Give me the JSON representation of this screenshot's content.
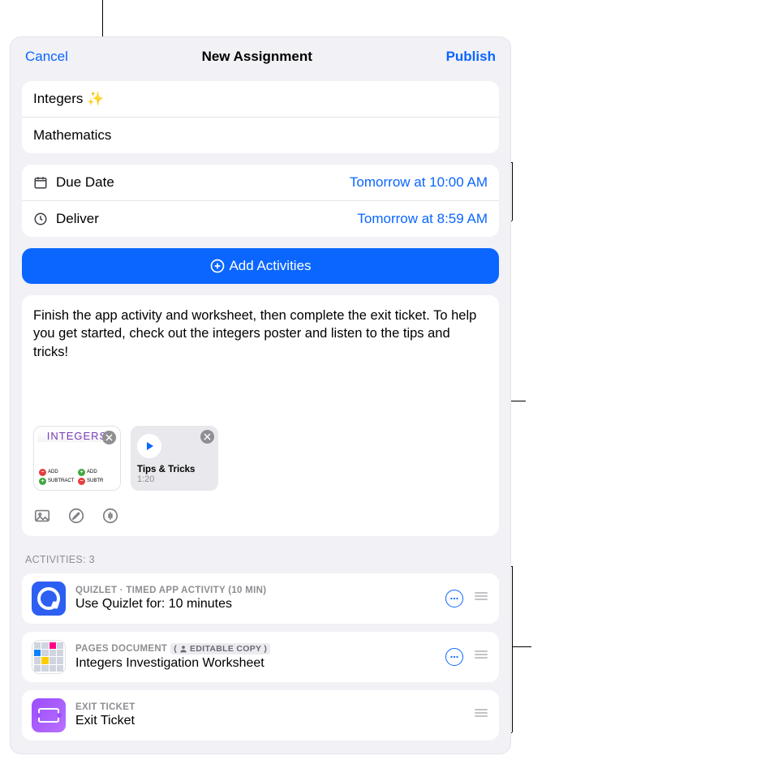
{
  "header": {
    "cancel": "Cancel",
    "title": "New Assignment",
    "publish": "Publish"
  },
  "title_field": "Integers ✨",
  "class_field": "Mathematics",
  "due": {
    "label": "Due Date",
    "value": "Tomorrow at 10:00 AM"
  },
  "deliver": {
    "label": "Deliver",
    "value": "Tomorrow at 8:59 AM"
  },
  "add_activities_label": "Add Activities",
  "description": "Finish the app activity and worksheet, then complete the exit ticket. To help you get started, check out the integers poster and listen to the tips and tricks!",
  "attachments": {
    "poster_title": "INTEGERS",
    "audio_title": "Tips & Tricks",
    "audio_duration": "1:20"
  },
  "activities_header": "ACTIVITIES: 3",
  "activities": [
    {
      "meta": "QUIZLET · TIMED APP ACTIVITY (10 MIN)",
      "title": "Use Quizlet for: 10 minutes",
      "has_badge": false,
      "has_more": true
    },
    {
      "meta": "PAGES DOCUMENT",
      "badge": "EDITABLE COPY",
      "title": "Integers Investigation Worksheet",
      "has_badge": true,
      "has_more": true
    },
    {
      "meta": "EXIT TICKET",
      "title": "Exit Ticket",
      "has_badge": false,
      "has_more": false
    }
  ]
}
